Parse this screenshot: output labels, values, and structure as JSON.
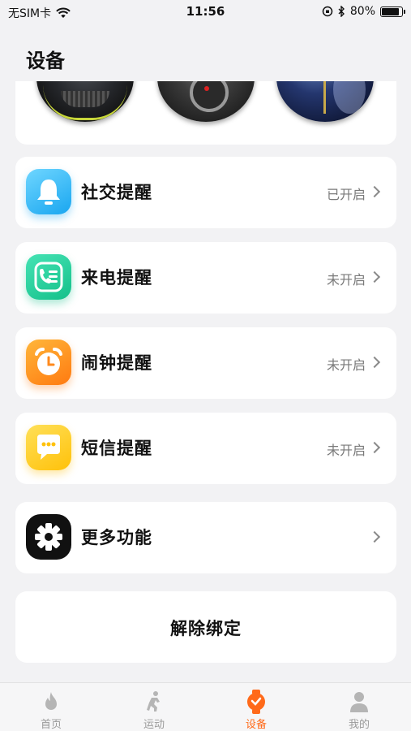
{
  "status_bar": {
    "carrier": "无SIM卡",
    "time": "11:56",
    "battery": "80%",
    "battery_level": 0.8
  },
  "header": {
    "title": "设备"
  },
  "watch_faces": [
    {
      "icon": "watch-face-1"
    },
    {
      "icon": "watch-face-2"
    },
    {
      "icon": "watch-face-3"
    }
  ],
  "settings": [
    {
      "label": "社交提醒",
      "status": "已开启",
      "icon": "bell-icon",
      "color": "#19a6f0"
    },
    {
      "label": "来电提醒",
      "status": "未开启",
      "icon": "phone-icon",
      "color": "#14c08a"
    },
    {
      "label": "闹钟提醒",
      "status": "未开启",
      "icon": "alarm-clock-icon",
      "color": "#ff7a10"
    },
    {
      "label": "短信提醒",
      "status": "未开启",
      "icon": "message-icon",
      "color": "#ffc10a"
    },
    {
      "label": "更多功能",
      "status": "",
      "icon": "gear-icon",
      "color": "#111111"
    }
  ],
  "unbind": {
    "label": "解除绑定"
  },
  "tabs": [
    {
      "label": "首页",
      "icon": "flame-icon",
      "active": false
    },
    {
      "label": "运动",
      "icon": "running-icon",
      "active": false
    },
    {
      "label": "设备",
      "icon": "watch-icon",
      "active": true
    },
    {
      "label": "我的",
      "icon": "person-icon",
      "active": false
    }
  ],
  "colors": {
    "accent": "#ff6a1a",
    "inactive_tab": "#9a9a9a",
    "background": "#f2f2f4"
  }
}
